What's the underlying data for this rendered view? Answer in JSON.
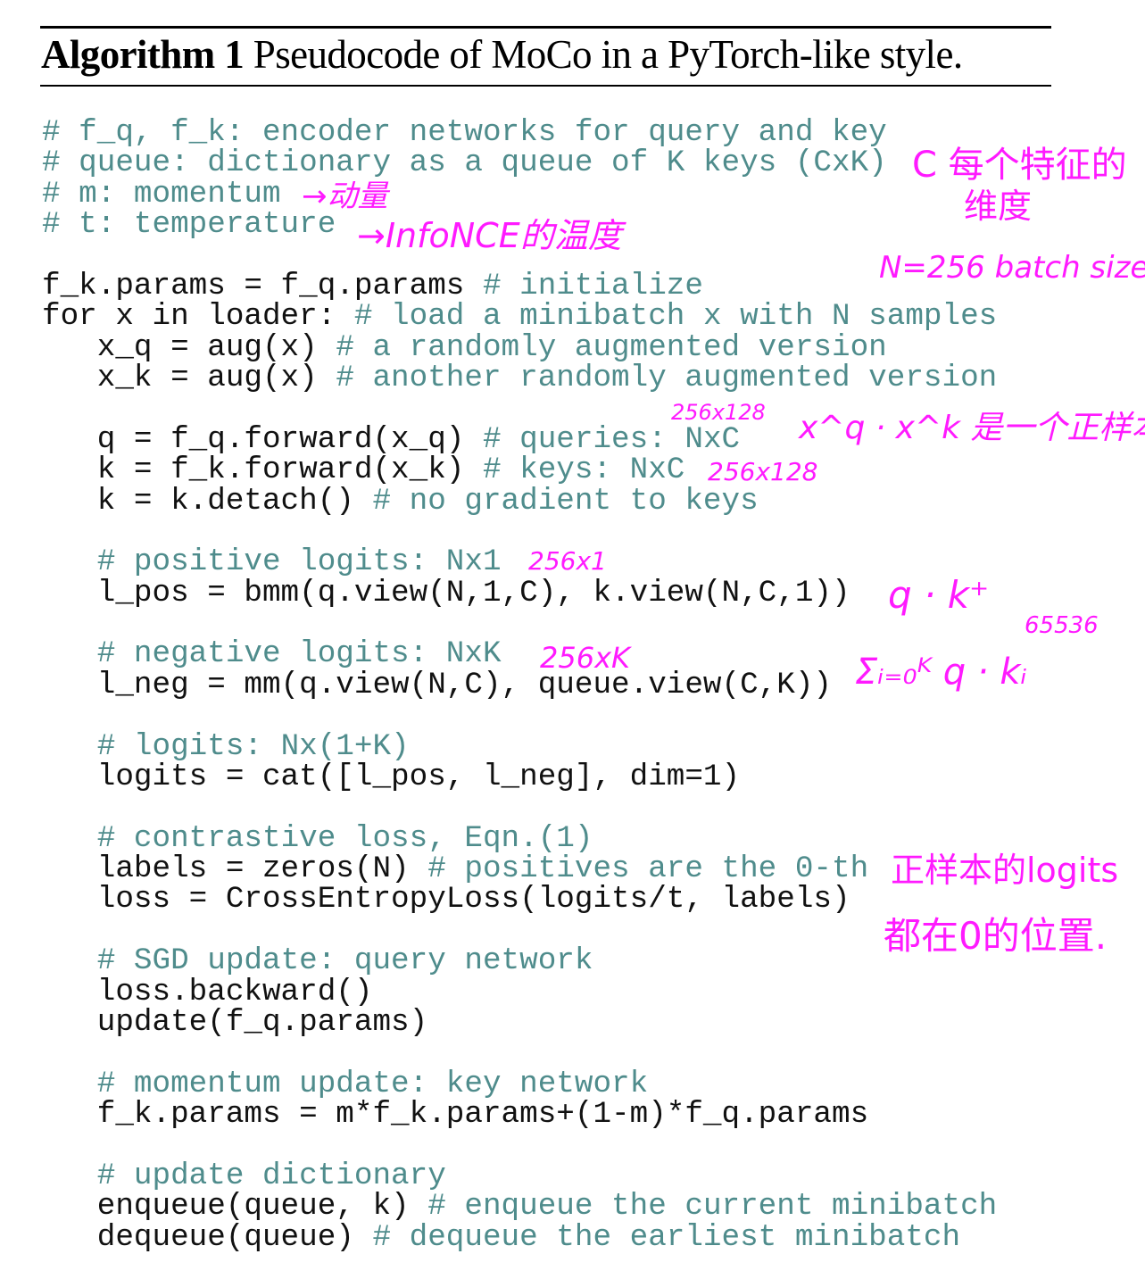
{
  "title": {
    "label": "Algorithm 1",
    "caption": "Pseudocode of MoCo in a PyTorch-like style."
  },
  "code_lines": [
    {
      "code": "",
      "comment": "# f_q, f_k: encoder networks for query and key"
    },
    {
      "code": "",
      "comment": "# queue: dictionary as a queue of K keys (CxK)"
    },
    {
      "code": "",
      "comment": "# m: momentum"
    },
    {
      "code": "",
      "comment": "# t: temperature"
    },
    {
      "code": "",
      "comment": ""
    },
    {
      "code": "f_k.params = f_q.params ",
      "comment": "# initialize"
    },
    {
      "code": "for x in loader: ",
      "comment": "# load a minibatch x with N samples"
    },
    {
      "code": "   x_q = aug(x) ",
      "comment": "# a randomly augmented version"
    },
    {
      "code": "   x_k = aug(x) ",
      "comment": "# another randomly augmented version"
    },
    {
      "code": "",
      "comment": ""
    },
    {
      "code": "   q = f_q.forward(x_q) ",
      "comment": "# queries: NxC"
    },
    {
      "code": "   k = f_k.forward(x_k) ",
      "comment": "# keys: NxC"
    },
    {
      "code": "   k = k.detach() ",
      "comment": "# no gradient to keys"
    },
    {
      "code": "",
      "comment": ""
    },
    {
      "code": "   ",
      "comment": "# positive logits: Nx1"
    },
    {
      "code": "   l_pos = bmm(q.view(N,1,C), k.view(N,C,1))",
      "comment": ""
    },
    {
      "code": "",
      "comment": ""
    },
    {
      "code": "   ",
      "comment": "# negative logits: NxK"
    },
    {
      "code": "   l_neg = mm(q.view(N,C), queue.view(C,K))",
      "comment": ""
    },
    {
      "code": "",
      "comment": ""
    },
    {
      "code": "   ",
      "comment": "# logits: Nx(1+K)"
    },
    {
      "code": "   logits = cat([l_pos, l_neg], dim=1)",
      "comment": ""
    },
    {
      "code": "",
      "comment": ""
    },
    {
      "code": "   ",
      "comment": "# contrastive loss, Eqn.(1)"
    },
    {
      "code": "   labels = zeros(N) ",
      "comment": "# positives are the 0-th"
    },
    {
      "code": "   loss = CrossEntropyLoss(logits/t, labels)",
      "comment": ""
    },
    {
      "code": "",
      "comment": ""
    },
    {
      "code": "   ",
      "comment": "# SGD update: query network"
    },
    {
      "code": "   loss.backward()",
      "comment": ""
    },
    {
      "code": "   update(f_q.params)",
      "comment": ""
    },
    {
      "code": "",
      "comment": ""
    },
    {
      "code": "   ",
      "comment": "# momentum update: key network"
    },
    {
      "code": "   f_k.params = m*f_k.params+(1-m)*f_q.params",
      "comment": ""
    },
    {
      "code": "",
      "comment": ""
    },
    {
      "code": "   ",
      "comment": "# update dictionary"
    },
    {
      "code": "   enqueue(queue, k) ",
      "comment": "# enqueue the current minibatch"
    },
    {
      "code": "   dequeue(queue) ",
      "comment": "# dequeue the earliest minibatch"
    }
  ],
  "annotations": {
    "momentum": "→动量",
    "temperature": "→InfoNCE的温度",
    "c_dim_line1": "C 每个特征的",
    "c_dim_line2": "维度",
    "batch_size": "N=256 batch size",
    "q_shape": "256x128",
    "xq_xk_note": "x^q · x^k 是一个正样本对",
    "k_shape": "256x128",
    "pos_shape": "256x1",
    "q_dot_kplus": "q · k⁺",
    "neg_shape": "256xK",
    "queue_size": "65536",
    "neg_sum": "Σᵢ₌₀ᴷ q · kᵢ",
    "labels_note_line1": "正样本的logits",
    "labels_note_line2": "都在0的位置."
  },
  "colors": {
    "comment": "#4f8c8c",
    "code": "#111111",
    "annotation": "#ff1aff"
  }
}
